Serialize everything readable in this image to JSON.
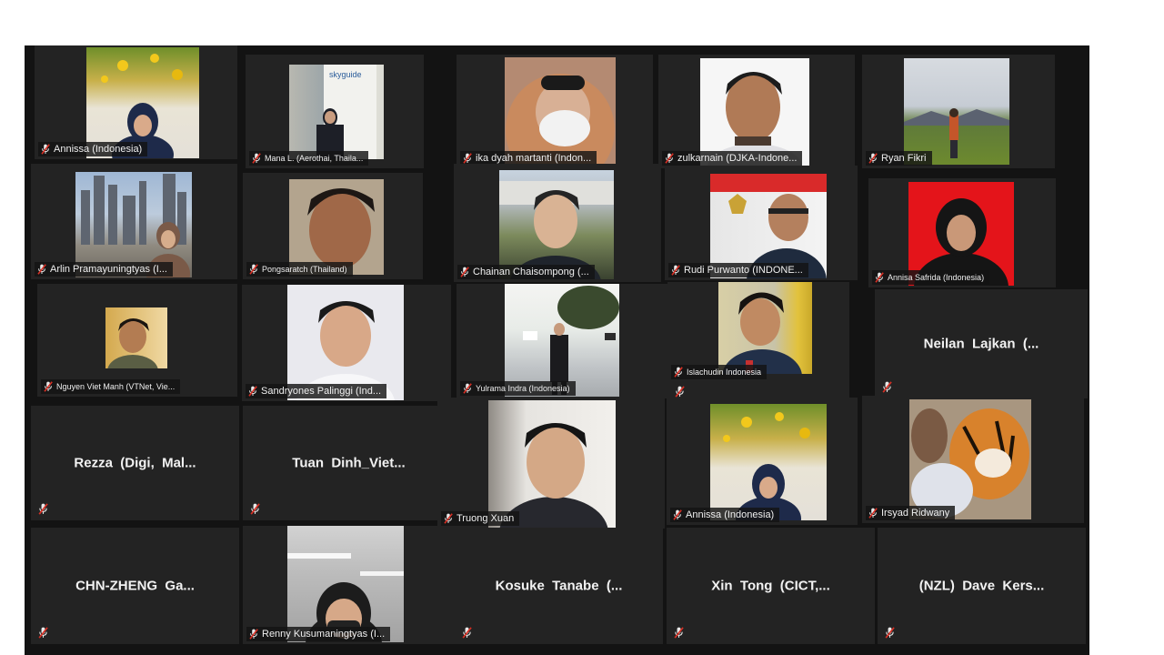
{
  "meeting": {
    "layout": "gallery-view",
    "mute_color": "#d93025",
    "tile_color": "#232323",
    "background_color": "#131313"
  },
  "participants": [
    {
      "name": "Annissa (Indonesia)",
      "video": true,
      "muted": true
    },
    {
      "name": "Mana L. (Aerothai, Thaila...",
      "video": true,
      "muted": true
    },
    {
      "name": "ika dyah martanti (Indon...",
      "video": true,
      "muted": true
    },
    {
      "name": "zulkarnain (DJKA-Indone...",
      "video": true,
      "muted": true
    },
    {
      "name": "Ryan Fikri",
      "video": true,
      "muted": true
    },
    {
      "name": "Arlin Pramayuningtyas (I...",
      "video": true,
      "muted": true
    },
    {
      "name": "Pongsaratch (Thailand)",
      "video": true,
      "muted": true
    },
    {
      "name": "Chainan Chaisompong (...",
      "video": true,
      "muted": true
    },
    {
      "name": "Rudi Purwanto (INDONE...",
      "video": true,
      "muted": true
    },
    {
      "name": "Annisa Safrida (Indonesia)",
      "video": true,
      "muted": true
    },
    {
      "name": "Nguyen Viet Manh (VTNet, Vie...",
      "video": true,
      "muted": true
    },
    {
      "name": "Sandryones Palinggi (Ind...",
      "video": true,
      "muted": true
    },
    {
      "name": "Yulrama Indra (Indonesia)",
      "video": true,
      "muted": true
    },
    {
      "name": "Islachudin Indonesia",
      "video": true,
      "muted": true
    },
    {
      "name": "Neilan  Lajkan  (...",
      "video": false,
      "muted": true
    },
    {
      "name": "Rezza  (Digi,  Mal...",
      "video": false,
      "muted": true
    },
    {
      "name": "Tuan  Dinh_Viet...",
      "video": false,
      "muted": true
    },
    {
      "name": "Truong Xuan",
      "video": true,
      "muted": true
    },
    {
      "name": "Annissa (Indonesia)",
      "video": true,
      "muted": true
    },
    {
      "name": "Irsyad Ridwany",
      "video": true,
      "muted": true
    },
    {
      "name": "CHN-ZHENG  Ga...",
      "video": false,
      "muted": true
    },
    {
      "name": "Renny Kusumaningtyas (I...",
      "video": true,
      "muted": true
    },
    {
      "name": "Kosuke  Tanabe  (...",
      "video": false,
      "muted": true
    },
    {
      "name": "Xin  Tong  (CICT,...",
      "video": false,
      "muted": true
    },
    {
      "name": "(NZL)  Dave  Kers...",
      "video": false,
      "muted": true
    }
  ]
}
